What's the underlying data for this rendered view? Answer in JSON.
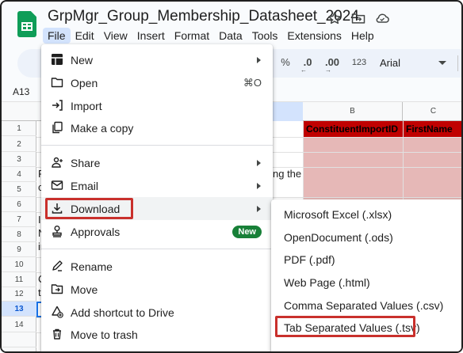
{
  "app": {
    "document_title": "GrpMgr_Group_Membership_Datasheet_2024",
    "title_icons": [
      "star-icon",
      "move-to-folder-icon",
      "cloud-status-icon"
    ]
  },
  "menubar": {
    "items": [
      "File",
      "Edit",
      "View",
      "Insert",
      "Format",
      "Data",
      "Tools",
      "Extensions",
      "Help"
    ],
    "active": "File"
  },
  "toolbar": {
    "percent": "%",
    "decrease_decimal": ".0",
    "increase_decimal": ".00",
    "number_format": "123",
    "font": "Arial"
  },
  "namebox": {
    "cell_ref": "A13"
  },
  "grid": {
    "column_headers": [
      "B",
      "C"
    ],
    "row_numbers": [
      "1",
      "2",
      "3",
      "4",
      "5",
      "6",
      "7",
      "8",
      "9",
      "10",
      "11",
      "12",
      "13",
      "14"
    ],
    "selected_row": "13",
    "header_cells": [
      "ConstituentImportID",
      "FirstName"
    ],
    "partial_text": {
      "r4_left": "F",
      "r4_right": "ng the",
      "r5_left": "c",
      "r7_left": "Ir",
      "r8_left": "N",
      "r9_left": "ir",
      "r11_left": "C",
      "r12_left": "tl"
    },
    "colors": {
      "header_fill": "#c00000",
      "body_fill": "#e6b8b7",
      "selection": "#1a73e8"
    }
  },
  "file_menu": {
    "items": [
      {
        "label": "New",
        "icon": "new-sheet-icon",
        "submenu": true
      },
      {
        "label": "Open",
        "icon": "folder-icon",
        "shortcut": "⌘O"
      },
      {
        "label": "Import",
        "icon": "import-icon"
      },
      {
        "label": "Make a copy",
        "icon": "copy-icon"
      },
      {
        "label": "Share",
        "icon": "share-person-icon",
        "submenu": true
      },
      {
        "label": "Email",
        "icon": "email-icon",
        "submenu": true
      },
      {
        "label": "Download",
        "icon": "download-icon",
        "submenu": true,
        "highlighted": true
      },
      {
        "label": "Approvals",
        "icon": "approvals-icon",
        "badge": "New"
      },
      {
        "label": "Rename",
        "icon": "rename-icon"
      },
      {
        "label": "Move",
        "icon": "move-folder-icon"
      },
      {
        "label": "Add shortcut to Drive",
        "icon": "add-shortcut-icon"
      },
      {
        "label": "Move to trash",
        "icon": "trash-icon"
      }
    ]
  },
  "download_submenu": {
    "items": [
      "Microsoft Excel (.xlsx)",
      "OpenDocument (.ods)",
      "PDF (.pdf)",
      "Web Page (.html)",
      "Comma Separated Values (.csv)",
      "Tab Separated Values (.tsv)"
    ],
    "emphasized": "Tab Separated Values (.tsv)"
  }
}
